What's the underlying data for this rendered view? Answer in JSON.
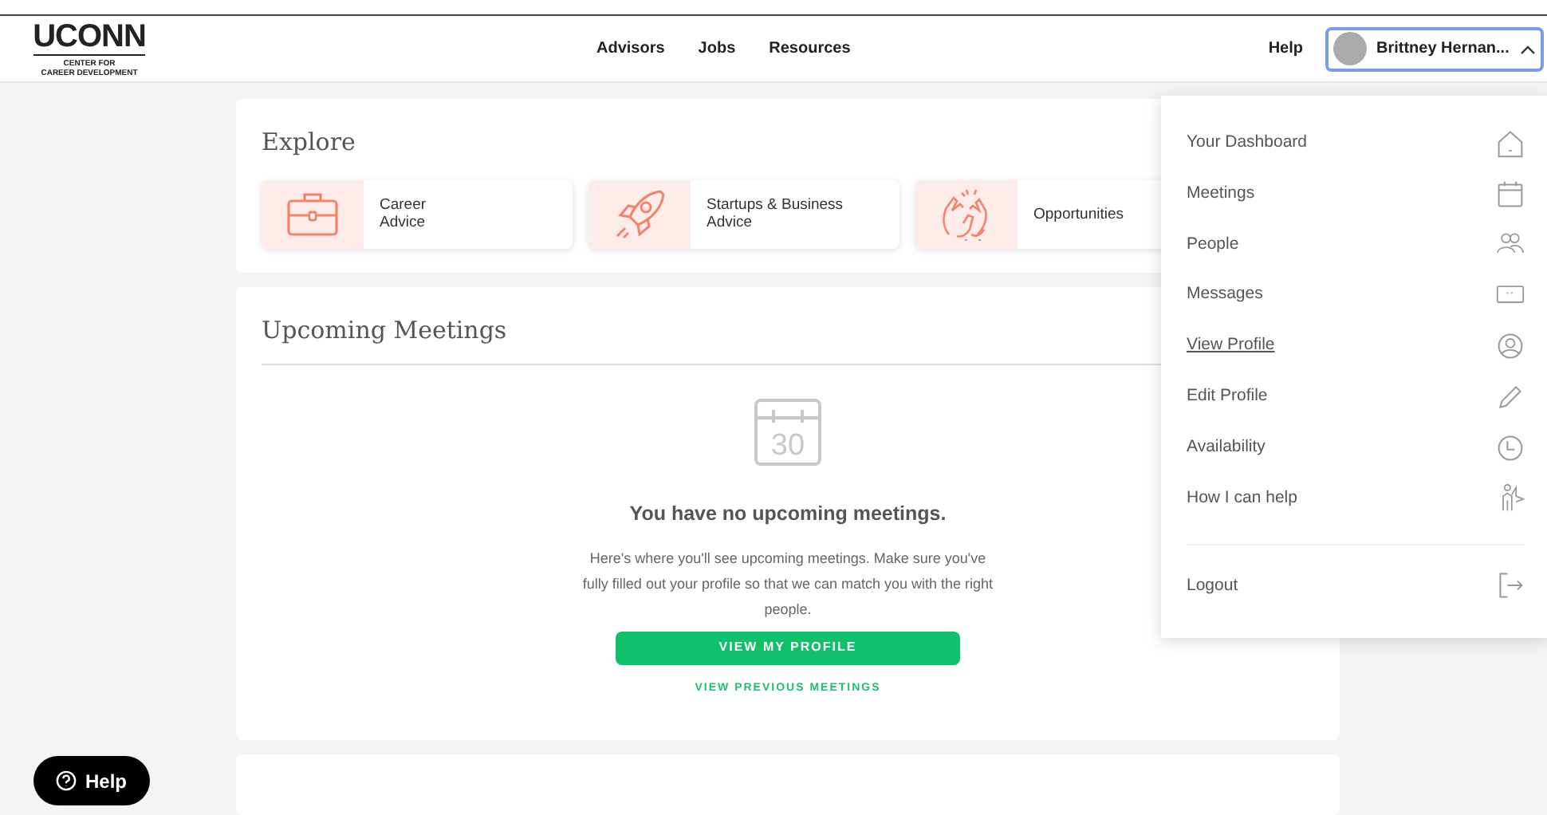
{
  "header": {
    "logo": {
      "title": "UCONN",
      "subtitle_1": "CENTER FOR",
      "subtitle_2": "CAREER DEVELOPMENT"
    },
    "nav": [
      "Advisors",
      "Jobs",
      "Resources"
    ],
    "help": "Help",
    "user": {
      "name": "Brittney Hernan...",
      "expanded": true
    }
  },
  "explore": {
    "title": "Explore",
    "cards": [
      {
        "label": "Career Advice"
      },
      {
        "label": "Startups & Business Advice"
      },
      {
        "label": "Opportunities"
      }
    ]
  },
  "meetings": {
    "title": "Upcoming Meetings",
    "calendar_day": "30",
    "empty_title": "You have no upcoming meetings.",
    "empty_text": "Here's where you'll see upcoming meetings. Make sure you've fully filled out your profile so that we can match you with the right people.",
    "primary_button": "VIEW MY PROFILE",
    "secondary_link": "VIEW PREVIOUS MEETINGS"
  },
  "user_menu": {
    "items": [
      {
        "label": "Your Dashboard",
        "selected": false
      },
      {
        "label": "Meetings",
        "selected": false
      },
      {
        "label": "People",
        "selected": false
      },
      {
        "label": "Messages",
        "selected": false
      },
      {
        "label": "View Profile",
        "selected": true
      },
      {
        "label": "Edit Profile",
        "selected": false
      },
      {
        "label": "Availability",
        "selected": false
      },
      {
        "label": "How I can help",
        "selected": false
      }
    ],
    "logout": {
      "label": "Logout"
    }
  },
  "help_button": "Help"
}
